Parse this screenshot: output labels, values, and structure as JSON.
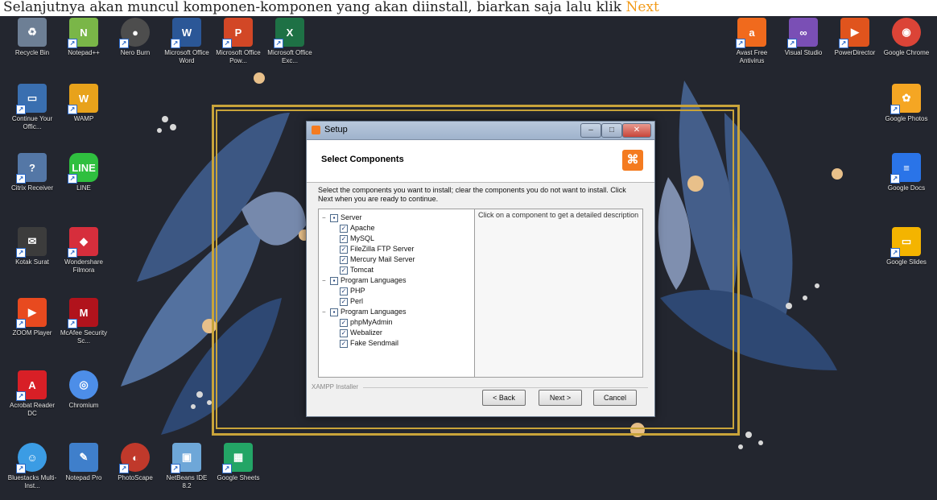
{
  "caption": {
    "text": "Selanjutnya akan muncul komponen-komponen yang akan diinstall, biarkan saja lalu klik ",
    "highlight": "Next"
  },
  "colors": {
    "highlight": "#f29b1a",
    "frame": "#c9a43a",
    "desktop_bg": "#23262f"
  },
  "desktop_icons_left": [
    {
      "label": "Recycle Bin",
      "icon": "recycle-bin-icon",
      "color": "#6d7f95"
    },
    {
      "label": "Notepad++",
      "icon": "notepad-plus-icon",
      "color": "#7ab648"
    },
    {
      "label": "Nero Burn",
      "icon": "nero-icon",
      "color": "#4d4d4d"
    },
    {
      "label": "Microsoft Office Word",
      "icon": "word-icon",
      "color": "#2b5797"
    },
    {
      "label": "Microsoft Office Pow...",
      "icon": "powerpoint-icon",
      "color": "#d24726"
    },
    {
      "label": "Microsoft Office Exc...",
      "icon": "excel-icon",
      "color": "#1e7145"
    },
    {
      "label": "Continue Your Offic...",
      "icon": "computer-icon",
      "color": "#3a6fb0"
    },
    {
      "label": "WAMP",
      "icon": "wamp-icon",
      "color": "#e8a21b"
    },
    {
      "label": "Citrix Receiver",
      "icon": "citrix-icon",
      "color": "#5477a6"
    },
    {
      "label": "LINE",
      "icon": "line-icon",
      "color": "#2fbf3f"
    },
    {
      "label": "Kotak Surat",
      "icon": "mail-icon",
      "color": "#3c3c3c"
    },
    {
      "label": "Wondershare Filmora",
      "icon": "filmora-icon",
      "color": "#d62e3c"
    },
    {
      "label": "ZOOM Player",
      "icon": "zoom-player-icon",
      "color": "#e84a1f"
    },
    {
      "label": "McAfee Security Sc...",
      "icon": "mcafee-icon",
      "color": "#b1131c"
    },
    {
      "label": "Acrobat Reader DC",
      "icon": "acrobat-icon",
      "color": "#d81f26"
    },
    {
      "label": "Chromium",
      "icon": "chromium-icon",
      "color": "#4d8ee8"
    },
    {
      "label": "Bluestacks Multi-Inst...",
      "icon": "bluestacks-icon",
      "color": "#3b9ce4"
    },
    {
      "label": "Notepad Pro",
      "icon": "notepad-pro-icon",
      "color": "#3f7fcb"
    },
    {
      "label": "PhotoScape",
      "icon": "photoscape-icon",
      "color": "#c0392b"
    },
    {
      "label": "NetBeans IDE 8.2",
      "icon": "netbeans-icon",
      "color": "#6ea7d8"
    },
    {
      "label": "Google Sheets",
      "icon": "google-sheets-icon",
      "color": "#23a566"
    }
  ],
  "desktop_icons_right": [
    {
      "label": "Avast Free Antivirus",
      "icon": "avast-icon",
      "color": "#f06a1d"
    },
    {
      "label": "Visual Studio",
      "icon": "visual-studio-icon",
      "color": "#7a4fb5"
    },
    {
      "label": "PowerDirector",
      "icon": "powerdirector-icon",
      "color": "#e0541d"
    },
    {
      "label": "Google Chrome",
      "icon": "chrome-icon",
      "color": "#db4437"
    },
    {
      "label": "Google Photos",
      "icon": "google-photos-icon",
      "color": "#f5a623"
    },
    {
      "label": "Google Docs",
      "icon": "google-docs-icon",
      "color": "#2a74e8"
    },
    {
      "label": "Google Slides",
      "icon": "google-slides-icon",
      "color": "#f4b400"
    }
  ],
  "window": {
    "title": "Setup",
    "header_title": "Select Components",
    "description": "Select the components you want to install; clear the components you do not want to install. Click Next when you are ready to continue.",
    "info_text": "Click on a component to get a detailed description",
    "brand": "XAMPP Installer",
    "buttons": {
      "back": "< Back",
      "next": "Next >",
      "cancel": "Cancel"
    },
    "tree": [
      {
        "label": "Server",
        "level": 0,
        "expander": "−"
      },
      {
        "label": "Apache",
        "level": 1
      },
      {
        "label": "MySQL",
        "level": 1
      },
      {
        "label": "FileZilla FTP Server",
        "level": 1
      },
      {
        "label": "Mercury Mail Server",
        "level": 1
      },
      {
        "label": "Tomcat",
        "level": 1
      },
      {
        "label": "Program Languages",
        "level": 0,
        "expander": "−"
      },
      {
        "label": "PHP",
        "level": 1
      },
      {
        "label": "Perl",
        "level": 1
      },
      {
        "label": "Program Languages",
        "level": 0,
        "expander": "−"
      },
      {
        "label": "phpMyAdmin",
        "level": 1
      },
      {
        "label": "Webalizer",
        "level": 1
      },
      {
        "label": "Fake Sendmail",
        "level": 1
      }
    ]
  }
}
